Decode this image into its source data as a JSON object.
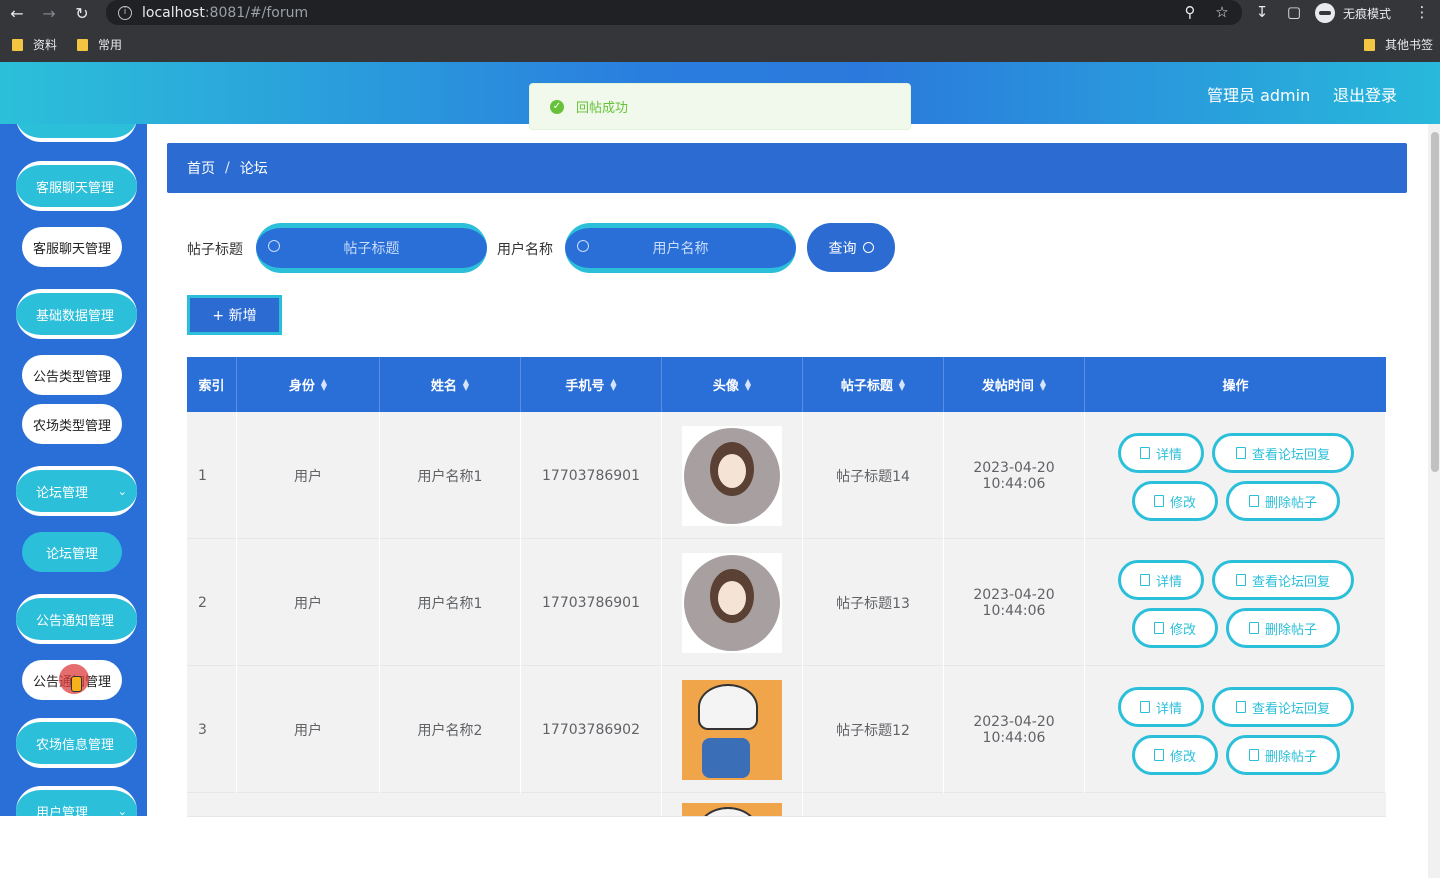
{
  "browser": {
    "url_host": "localhost",
    "url_path": ":8081/#/forum",
    "incognito_label": "无痕模式",
    "bookmarks": [
      "资料",
      "常用"
    ],
    "other_bookmarks": "其他书签"
  },
  "header": {
    "admin": "管理员 admin",
    "logout": "退出登录"
  },
  "toast": {
    "message": "回帖成功"
  },
  "sidebar": {
    "items": [
      {
        "label": "客服聊天管理",
        "type": "group"
      },
      {
        "label": "客服聊天管理",
        "type": "sub"
      },
      {
        "label": "基础数据管理",
        "type": "group"
      },
      {
        "label": "公告类型管理",
        "type": "sub"
      },
      {
        "label": "农场类型管理",
        "type": "sub"
      },
      {
        "label": "论坛管理",
        "type": "group"
      },
      {
        "label": "论坛管理",
        "type": "sub-active"
      },
      {
        "label": "公告通知管理",
        "type": "group"
      },
      {
        "label": "公告通知管理",
        "type": "sub"
      },
      {
        "label": "农场信息管理",
        "type": "group"
      },
      {
        "label": "用户管理",
        "type": "group"
      }
    ]
  },
  "breadcrumb": {
    "home": "首页",
    "separator": "/",
    "current": "论坛"
  },
  "filters": {
    "title_label": "帖子标题",
    "title_placeholder": "帖子标题",
    "user_label": "用户名称",
    "user_placeholder": "用户名称",
    "query": "查询"
  },
  "actions": {
    "add": "+ 新增"
  },
  "table": {
    "columns": [
      "索引",
      "身份",
      "姓名",
      "手机号",
      "头像",
      "帖子标题",
      "发帖时间",
      "操作"
    ],
    "rows": [
      {
        "index": "1",
        "role": "用户",
        "name": "用户名称1",
        "phone": "17703786901",
        "avatar": "girl-avatar",
        "title": "帖子标题14",
        "time": "2023-04-20 10:44:06"
      },
      {
        "index": "2",
        "role": "用户",
        "name": "用户名称1",
        "phone": "17703786901",
        "avatar": "girl-avatar",
        "title": "帖子标题13",
        "time": "2023-04-20 10:44:06"
      },
      {
        "index": "3",
        "role": "用户",
        "name": "用户名称2",
        "phone": "17703786902",
        "avatar": "cartoon-boy-avatar",
        "title": "帖子标题12",
        "time": "2023-04-20 10:44:06"
      }
    ],
    "row_actions": {
      "detail": "详情",
      "view_replies": "查看论坛回复",
      "edit": "修改",
      "delete": "删除帖子"
    }
  },
  "colors": {
    "primary": "#2a6fd8",
    "accent": "#2bbfda",
    "success": "#67c23a"
  }
}
